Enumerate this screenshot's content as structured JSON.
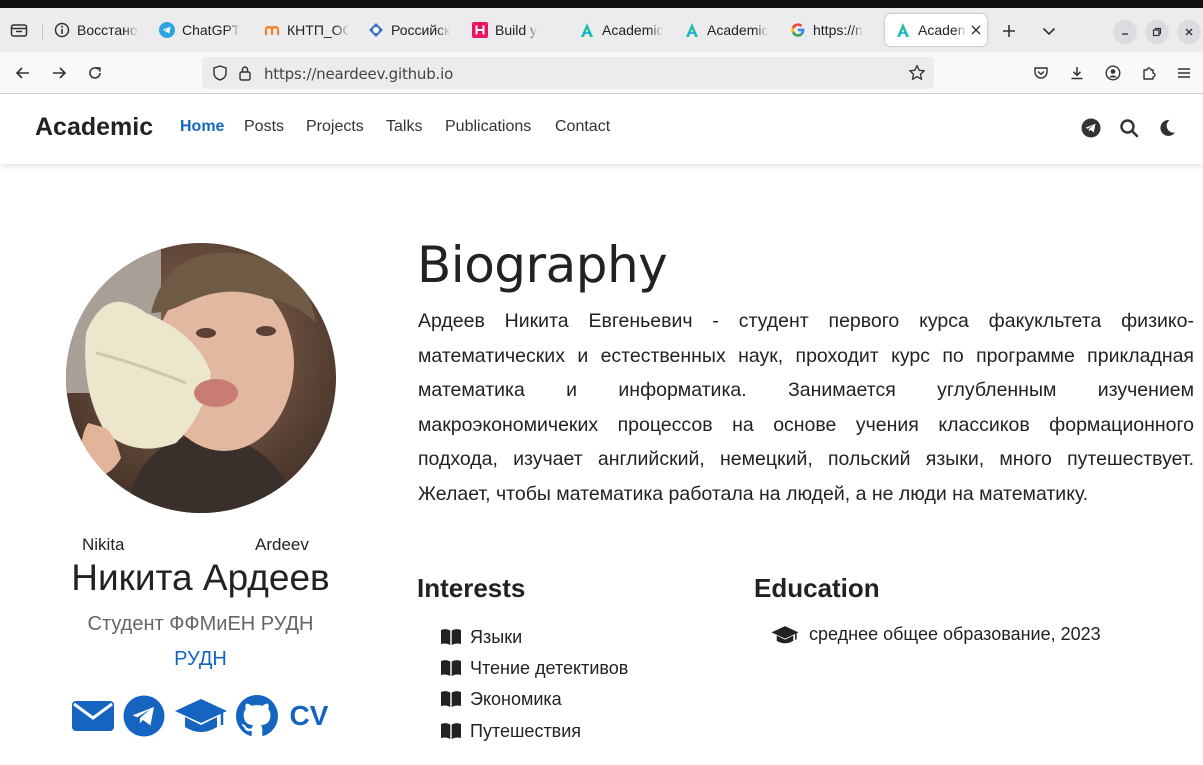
{
  "browser": {
    "tabs": [
      {
        "title": "Восстано",
        "icon": "info-circle-icon",
        "active": false
      },
      {
        "title": "ChatGPT",
        "icon": "telegram-icon",
        "active": false
      },
      {
        "title": "КНТП_ОС",
        "icon": "moodle-icon",
        "active": false
      },
      {
        "title": "Российск",
        "icon": "university-icon",
        "active": false
      },
      {
        "title": "Build y",
        "icon": "hexlet-icon",
        "active": false
      },
      {
        "title": "Academic",
        "icon": "academic-icon",
        "active": false
      },
      {
        "title": "Academic",
        "icon": "academic-icon",
        "active": false
      },
      {
        "title": "https://n",
        "icon": "google-icon",
        "active": false
      },
      {
        "title": "Academic",
        "icon": "academic-icon",
        "active": true
      }
    ],
    "url": "https://neardeev.github.io"
  },
  "site": {
    "brand": "Academic",
    "menu": [
      "Home",
      "Posts",
      "Projects",
      "Talks",
      "Publications",
      "Contact"
    ],
    "active_menu": "Home",
    "header_icons": [
      "telegram-icon",
      "search-icon",
      "moon-icon"
    ]
  },
  "profile": {
    "avatar_caption_first": "Nikita",
    "avatar_caption_last": "Ardeev",
    "name": "Никита Ардеев",
    "role": "Студент ФФМиЕН РУДН",
    "organization": "РУДН",
    "social": [
      "email-icon",
      "telegram-icon",
      "graduation-cap-icon",
      "github-icon",
      "cv-icon"
    ],
    "cv_label": "CV"
  },
  "biography": {
    "title": "Biography",
    "text": "Ардеев Никита Евгеньевич - студент первого курса факукльтета физико-математических и естественных наук, проходит курс по программе прикладная математика и информатика. Занимается углубленным изучением макроэкономичеких процессов на основе учения классиков формационного подхода, изучает английский, немецкий, польский языки, много путешествует. Желает, чтобы математика работала на людей, а не люди на математику."
  },
  "interests": {
    "title": "Interests",
    "items": [
      "Языки",
      "Чтение детективов",
      "Экономика",
      "Путешествия"
    ]
  },
  "education": {
    "title": "Education",
    "items": [
      "среднее общее образование, 2023"
    ]
  },
  "colors": {
    "accent": "#1565c0",
    "text": "#222222",
    "muted": "#666666"
  }
}
